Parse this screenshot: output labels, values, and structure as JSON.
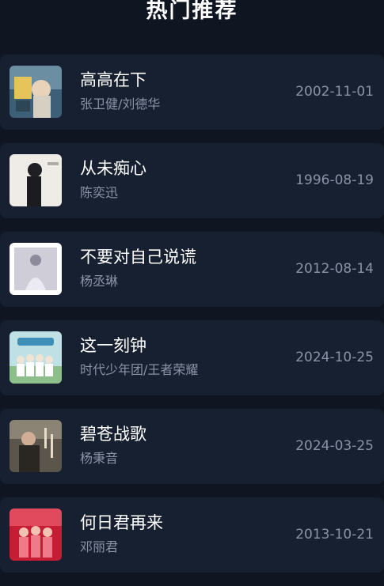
{
  "header": {
    "title": "热门推荐"
  },
  "songs": [
    {
      "title": "高高在下",
      "artist": "张卫健/刘德华",
      "date": "2002-11-01",
      "cover_icon": "album-cover-1"
    },
    {
      "title": "从未痴心",
      "artist": "陈奕迅",
      "date": "1996-08-19",
      "cover_icon": "album-cover-2"
    },
    {
      "title": "不要对自己说谎",
      "artist": "杨丞琳",
      "date": "2012-08-14",
      "cover_icon": "album-cover-3"
    },
    {
      "title": "这一刻钟",
      "artist": "时代少年团/王者荣耀",
      "date": "2024-10-25",
      "cover_icon": "album-cover-4"
    },
    {
      "title": "碧苍战歌",
      "artist": "杨秉音",
      "date": "2024-03-25",
      "cover_icon": "album-cover-5"
    },
    {
      "title": "何日君再来",
      "artist": "邓丽君",
      "date": "2013-10-21",
      "cover_icon": "album-cover-6"
    }
  ],
  "colors": {
    "background": "#0f1521",
    "card": "#172031",
    "secondary_text": "#8a93a6"
  }
}
